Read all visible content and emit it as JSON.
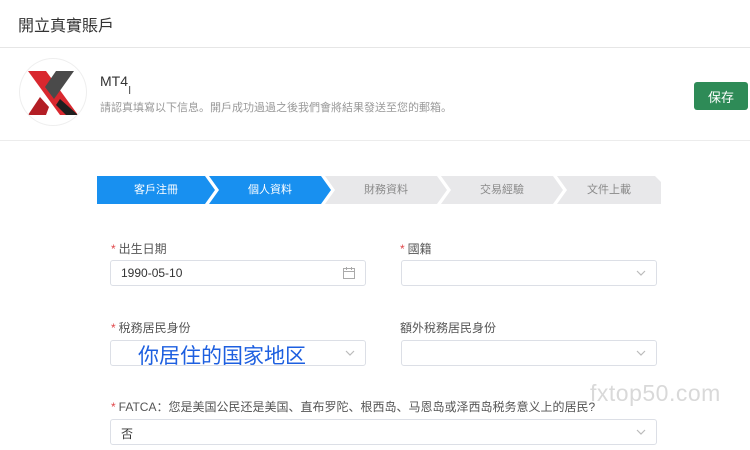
{
  "page": {
    "title": "開立真實賬戶"
  },
  "account": {
    "name": "MT4",
    "cursor": "Ⅰ",
    "description": "請認真填寫以下信息。開戶成功過過之後我們會將結果發送至您的郵箱。",
    "save_label": "保存"
  },
  "steps": [
    {
      "label": "客戶注冊",
      "active": true
    },
    {
      "label": "個人資料",
      "active": true
    },
    {
      "label": "財務資料",
      "active": false
    },
    {
      "label": "交易經驗",
      "active": false
    },
    {
      "label": "文件上載",
      "active": false
    }
  ],
  "colors": {
    "step_active": "#1890f0",
    "step_inactive": "#e8e8ea",
    "primary_button": "#2e8b57",
    "required": "#e0474a"
  },
  "form": {
    "birth_date": {
      "label": "出生日期",
      "required": true,
      "value": "1990-05-10"
    },
    "nationality": {
      "label": "國籍",
      "required": true,
      "value": ""
    },
    "tax_residency": {
      "label": "稅務居民身份",
      "required": true,
      "value": ""
    },
    "additional_tax_residency": {
      "label": "額外稅務居民身份",
      "required": false,
      "value": ""
    },
    "fatca": {
      "label": "FATCA：您是美国公民还是美国、直布罗陀、根西岛、马恩岛或泽西岛税务意义上的居民?",
      "required": true,
      "value": "否"
    }
  },
  "annotation": "你居住的国家地区",
  "watermark": "fxtop50.com",
  "icons": {
    "logo": "mt4-x-logo",
    "calendar": "calendar-icon",
    "chevron": "chevron-down-icon"
  }
}
